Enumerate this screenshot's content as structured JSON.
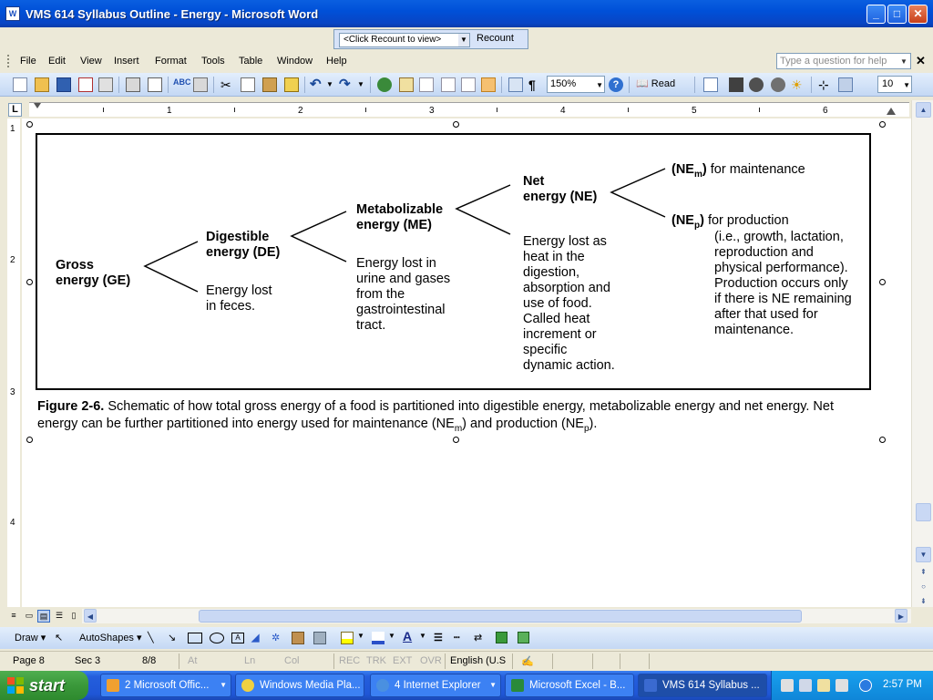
{
  "window": {
    "title": "VMS 614 Syllabus Outline - Energy - Microsoft Word"
  },
  "recount": {
    "combo_value": "<Click Recount to view>",
    "button_label": "Recount"
  },
  "menu": {
    "items": [
      "File",
      "Edit",
      "View",
      "Insert",
      "Format",
      "Tools",
      "Table",
      "Window",
      "Help"
    ],
    "help_placeholder": "Type a question for help"
  },
  "toolbar": {
    "zoom": "150%",
    "read_label": "Read",
    "font_size": "10"
  },
  "ruler": {
    "h_numbers": [
      "1",
      "2",
      "3",
      "4",
      "5",
      "6"
    ],
    "v_numbers": [
      "1",
      "2",
      "3",
      "4"
    ]
  },
  "figure": {
    "gross": [
      "Gross",
      "energy (GE)"
    ],
    "digestible": [
      "Digestible",
      "energy (DE)"
    ],
    "feces": [
      "Energy lost",
      "in feces."
    ],
    "metabolizable": [
      "Metabolizable",
      "energy (ME)"
    ],
    "urine": [
      "Energy lost in",
      "urine and gases",
      "from the",
      "gastrointestinal",
      "tract."
    ],
    "net": [
      "Net",
      "energy (NE)"
    ],
    "heat": [
      "Energy lost as",
      "heat in the",
      "digestion,",
      "absorption and",
      "use of food.",
      "Called heat",
      "increment or",
      "specific",
      "dynamic action."
    ],
    "nem": {
      "open": "(NE",
      "sub": "m",
      "close": ")",
      "text": " for maintenance"
    },
    "nep": {
      "open": "(NE",
      "sub": "p",
      "close": ")",
      "text": " for production"
    },
    "production": [
      "(i.e., growth, lactation,",
      "reproduction and",
      "physical performance).",
      "Production occurs only",
      "if there is NE remaining",
      "after that used for",
      "maintenance."
    ]
  },
  "caption": {
    "label": "Figure 2-6.",
    "text1": " Schematic of how total gross energy of a food is partitioned into digestible energy, metabolizable energy and net energy. Net energy can be further partitioned into energy used for maintenance (NE",
    "sub1": "m",
    "text2": ") and production (NE",
    "sub2": "p",
    "text3": ")."
  },
  "drawbar": {
    "draw_label": "Draw",
    "autoshapes_label": "AutoShapes"
  },
  "status": {
    "page": "Page  8",
    "sec": "Sec  3",
    "pages": "8/8",
    "at": "At",
    "ln": "Ln",
    "col": "Col",
    "rec": "REC",
    "trk": "TRK",
    "ext": "EXT",
    "ovr": "OVR",
    "lang": "English (U.S"
  },
  "taskbar": {
    "start_label": "start",
    "tasks": [
      "2 Microsoft Offic...",
      "Windows Media Pla...",
      "4 Internet Explorer",
      "Microsoft Excel - B...",
      "VMS 614 Syllabus ..."
    ],
    "clock": "2:57 PM"
  }
}
